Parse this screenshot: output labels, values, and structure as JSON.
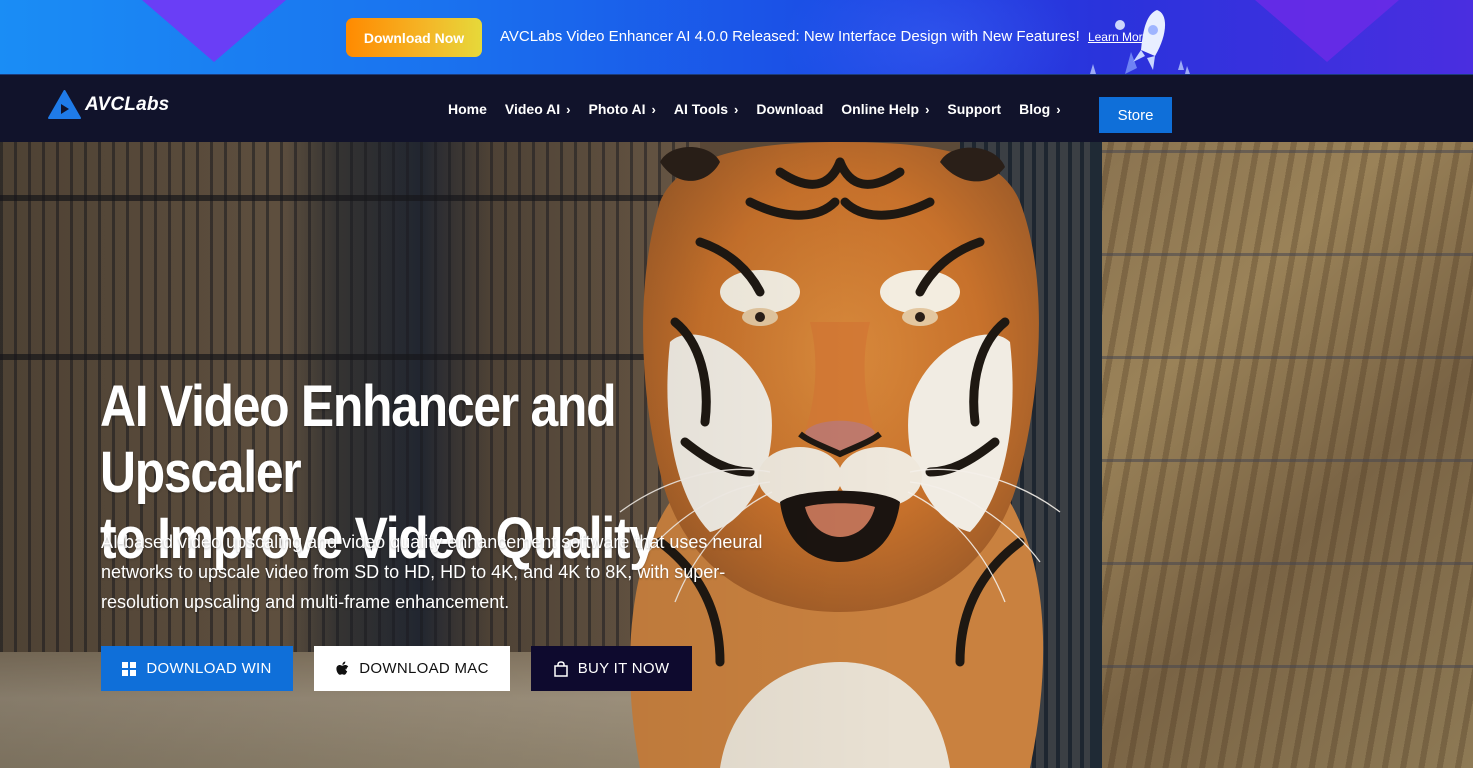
{
  "promo": {
    "download_button": "Download Now",
    "message": "AVCLabs Video Enhancer AI 4.0.0 Released: New Interface Design with New Features!",
    "learn_more": "Learn More",
    "icons": [
      "rocket-illustration"
    ]
  },
  "nav": {
    "logo_text": "AVCLabs",
    "items": [
      {
        "label": "Home",
        "has_submenu": false
      },
      {
        "label": "Video AI",
        "has_submenu": true
      },
      {
        "label": "Photo AI",
        "has_submenu": true
      },
      {
        "label": "AI Tools",
        "has_submenu": true
      },
      {
        "label": "Download",
        "has_submenu": false
      },
      {
        "label": "Online Help",
        "has_submenu": true
      },
      {
        "label": "Support",
        "has_submenu": false
      },
      {
        "label": "Blog",
        "has_submenu": true
      }
    ],
    "submenu_glyph": "›",
    "store_label": "Store"
  },
  "hero": {
    "title_line1": "AI Video Enhancer and Upscaler",
    "title_line2": "to Improve Video Quality",
    "description": "AI-based video upscaling and video quality enhancement software that uses neural networks to upscale video from SD to HD, HD to 4K, and 4K to 8K, with super-resolution upscaling and multi-frame enhancement.",
    "background_image": "tiger-behind-fence",
    "buttons": {
      "win": {
        "label": "DOWNLOAD WIN",
        "icon": "windows-icon"
      },
      "mac": {
        "label": "DOWNLOAD MAC",
        "icon": "apple-icon"
      },
      "buy": {
        "label": "BUY IT NOW",
        "icon": "shopping-bag-icon"
      }
    }
  },
  "colors": {
    "brand_blue": "#0f6fd9",
    "nav_bg": "#11132b",
    "buy_bg": "#0e0a2e",
    "promo_button_start": "#ff8a00",
    "promo_button_end": "#e6d93a"
  }
}
